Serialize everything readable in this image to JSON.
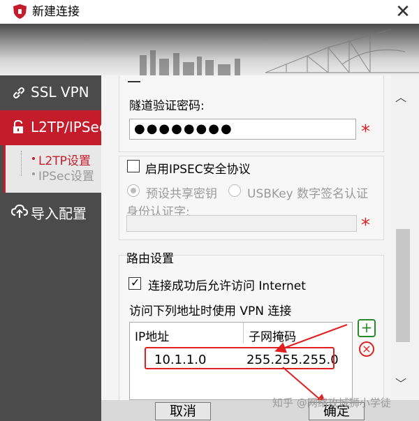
{
  "window": {
    "title": "新建连接",
    "close_glyph": "✕"
  },
  "colors": {
    "accent": "#c41c2b",
    "sidebar": "#4b4b4b",
    "required": "#e02020"
  },
  "sidebar": {
    "items": [
      {
        "label": "SSL VPN",
        "icon": "link-icon"
      },
      {
        "label": "L2TP/IPSec",
        "icon": "lock-icon"
      },
      {
        "label": "导入配置",
        "icon": "cloud-upload-icon"
      }
    ],
    "subitems": [
      {
        "label": "L2TP设置"
      },
      {
        "label": "IPSec设置"
      }
    ]
  },
  "tunnel": {
    "password_label": "隧道验证密码:",
    "password_value": "●●●●●●●●",
    "required_mark": "*"
  },
  "ipsec": {
    "enable_label": "启用IPSEC安全协议",
    "enabled": false,
    "preshared_label": "预设共享密钥",
    "usbkey_label": "USBKey 数字签名认证",
    "identity_label": "身份认证字:",
    "required_mark": "*"
  },
  "routing": {
    "title": "路由设置",
    "allow_internet_label": "连接成功后允许访问 Internet",
    "allow_internet_checked": true,
    "vpn_list_label": "访问下列地址时使用 VPN 连接",
    "columns": [
      "IP地址",
      "子网掩码"
    ],
    "rows": [
      {
        "ip": "10.1.1.0",
        "mask": "255.255.255.0"
      }
    ],
    "add_glyph": "+",
    "remove_glyph": "×"
  },
  "footer": {
    "cancel_label": "取消",
    "ok_label": "确定"
  },
  "scroll": {
    "up_glyph": "︿",
    "down_glyph": "﹀"
  },
  "watermark": "知乎 @网络攻城狮小学徒"
}
